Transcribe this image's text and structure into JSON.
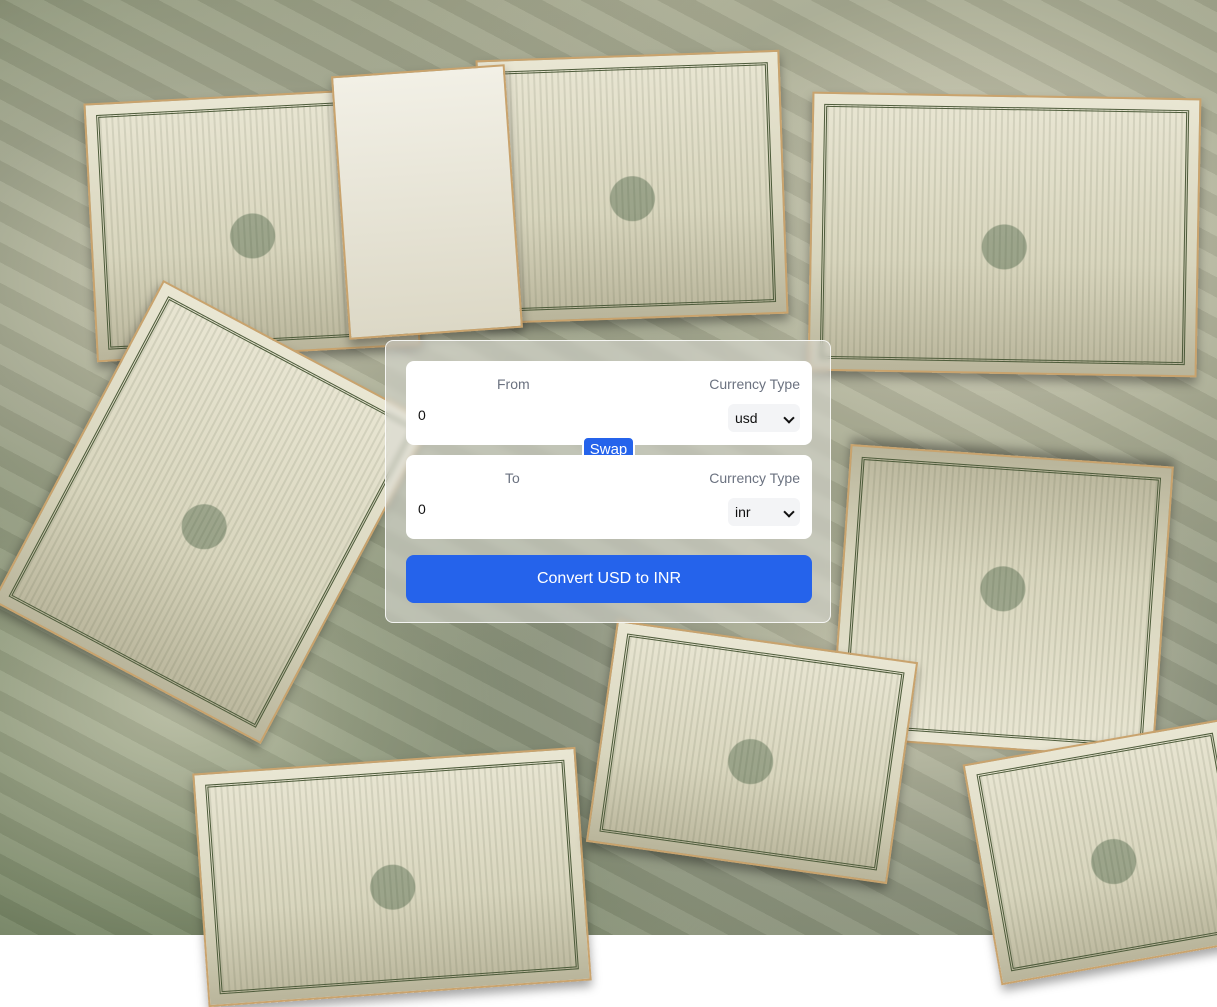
{
  "converter": {
    "from": {
      "label": "From",
      "currency_label": "Currency Type",
      "amount": "0",
      "currency": "usd"
    },
    "to": {
      "label": "To",
      "currency_label": "Currency Type",
      "amount": "0",
      "currency": "inr"
    },
    "swap_label": "Swap",
    "convert_label": "Convert USD to INR"
  },
  "colors": {
    "accent": "#2563eb",
    "card_background": "#ffffff"
  }
}
